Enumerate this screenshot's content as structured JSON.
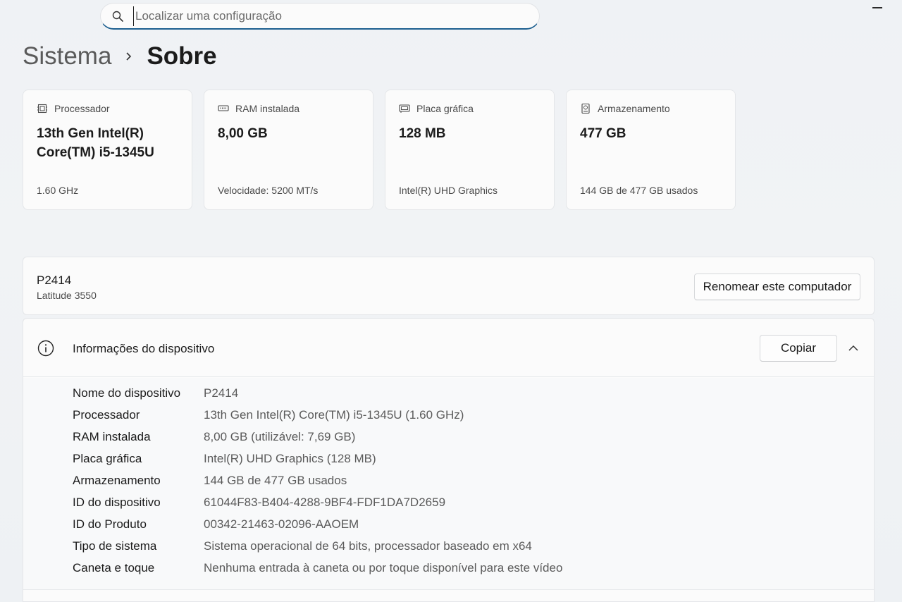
{
  "search": {
    "placeholder": "Localizar uma configuração"
  },
  "breadcrumb": {
    "parent": "Sistema",
    "current": "Sobre"
  },
  "cards": [
    {
      "label": "Processador",
      "value": "13th Gen Intel(R) Core(TM) i5-1345U",
      "sub": "1.60 GHz",
      "icon": "processor-icon"
    },
    {
      "label": "RAM instalada",
      "value": "8,00 GB",
      "sub": "Velocidade: 5200 MT/s",
      "icon": "ram-icon"
    },
    {
      "label": "Placa gráfica",
      "value": "128 MB",
      "sub": "Intel(R) UHD Graphics",
      "icon": "gpu-icon"
    },
    {
      "label": "Armazenamento",
      "value": "477 GB",
      "sub": "144 GB de 477 GB usados",
      "icon": "storage-icon"
    }
  ],
  "computer": {
    "name": "P2414",
    "model": "Latitude 3550",
    "rename_label": "Renomear este computador"
  },
  "device_info": {
    "title": "Informações do dispositivo",
    "copy_label": "Copiar",
    "rows": [
      {
        "key": "Nome do dispositivo",
        "value": "P2414"
      },
      {
        "key": "Processador",
        "value": "13th Gen Intel(R) Core(TM) i5-1345U (1.60 GHz)"
      },
      {
        "key": "RAM instalada",
        "value": "8,00 GB (utilizável: 7,69 GB)"
      },
      {
        "key": "Placa gráfica",
        "value": "Intel(R) UHD Graphics (128 MB)"
      },
      {
        "key": "Armazenamento",
        "value": "144 GB de 477 GB usados"
      },
      {
        "key": "ID do dispositivo",
        "value": "61044F83-B404-4288-9BF4-FDF1DA7D2659"
      },
      {
        "key": "ID do Produto",
        "value": "00342-21463-02096-AAOEM"
      },
      {
        "key": "Tipo de sistema",
        "value": "Sistema operacional de 64 bits, processador baseado em x64"
      },
      {
        "key": "Caneta e toque",
        "value": "Nenhuma entrada à caneta ou por toque disponível para este vídeo"
      }
    ]
  },
  "colors": {
    "accent": "#1c5f8f",
    "background": "#eef1f4",
    "card": "#fbfbfb"
  }
}
